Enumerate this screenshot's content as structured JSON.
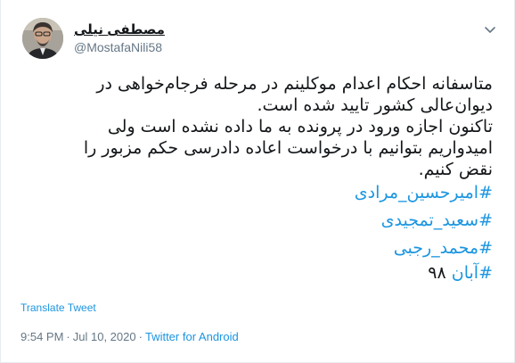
{
  "author": {
    "display_name": "مصطفی نیلی",
    "handle": "@MostafaNili58"
  },
  "tweet": {
    "lines": [
      "متاسفانه احکام اعدام موکلینم در مرحله فرجام‌خواهی در",
      "دیوان‌عالی کشور تایید شده است.",
      "تاکنون اجازه ورود در پرونده به ما داده نشده است ولی",
      "امیدواریم بتوانیم با درخواست اعاده دادرسی حکم مزبور را",
      "نقض کنیم."
    ],
    "hashtags": [
      "#امیرحسین_مرادی",
      "#سعید_تمجیدی",
      "#محمد_رجبی"
    ],
    "last_tag": "#آبان",
    "last_tag_suffix": " ۹۸"
  },
  "translate_label": "Translate Tweet",
  "meta": {
    "time": "9:54 PM",
    "separator": "·",
    "date": "Jul 10, 2020",
    "source": "Twitter for Android"
  },
  "colors": {
    "link": "#1b95e0",
    "secondary": "#657786",
    "text": "#14171a"
  },
  "icons": {
    "caret": "chevron-down-icon",
    "avatar": "avatar-photo"
  }
}
